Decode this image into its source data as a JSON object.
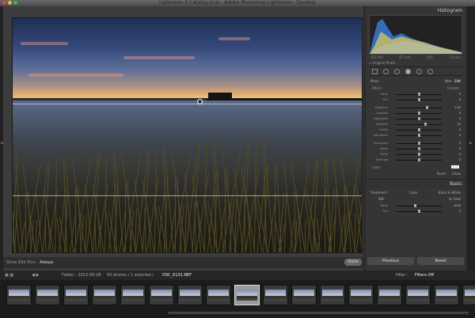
{
  "window": {
    "title": "Lightroom 5 Catalog.lrcat - Adobe Photoshop Lightroom - Develop"
  },
  "histogram": {
    "title": "Histogram",
    "labels": [
      "ISO 100",
      "17 mm",
      "f/11",
      "2.0 sec"
    ],
    "original_photo": "Original Photo"
  },
  "mask": {
    "label": "Mask :",
    "new": "New",
    "edit": "Edit"
  },
  "effect": {
    "label": "Effect :",
    "value": "Custom"
  },
  "sliders": [
    {
      "label": "Temp",
      "value": "0",
      "pos": 0.5
    },
    {
      "label": "Tint",
      "value": "0",
      "pos": 0.5
    },
    {
      "label": "Exposure",
      "value": "1.00",
      "pos": 0.68
    },
    {
      "label": "Contrast",
      "value": "0",
      "pos": 0.5
    },
    {
      "label": "Highlights",
      "value": "0",
      "pos": 0.5
    },
    {
      "label": "Shadows",
      "value": "33",
      "pos": 0.63
    },
    {
      "label": "Clarity",
      "value": "0",
      "pos": 0.5
    },
    {
      "label": "Saturation",
      "value": "0",
      "pos": 0.5
    },
    {
      "label": "Sharpness",
      "value": "0",
      "pos": 0.5
    },
    {
      "label": "Noise",
      "value": "0",
      "pos": 0.5
    },
    {
      "label": "Moiré",
      "value": "0",
      "pos": 0.5
    },
    {
      "label": "Defringe",
      "value": "0",
      "pos": 0.5
    }
  ],
  "color": {
    "label": "Color"
  },
  "panel": {
    "reset": "Reset",
    "close": "Close"
  },
  "basic": {
    "title": "Basic",
    "treatment": "Treatment :",
    "color": "Color",
    "bw": "Black & White",
    "wb_label": "WB :",
    "wb_value": "As Shot",
    "temp": "Temp",
    "temp_value": "4000",
    "tint": "Tint",
    "tint_value": "0"
  },
  "buttons": {
    "previous": "Previous",
    "reset": "Reset",
    "done": "Done"
  },
  "toolbar": {
    "show_edit_pins": "Show Edit Pins :",
    "edit_pins_value": "Always"
  },
  "filmstrip": {
    "folder": "Folder : 2013-09-28",
    "count": "50 photos / 1 selected /",
    "file": "DSC_6131.NEF",
    "filter": "Filter :",
    "filter_value": "Filters Off",
    "thumb_count": 17,
    "selected_index": 8
  },
  "colors": {
    "accent": "#f0d090",
    "panel": "#353535"
  }
}
